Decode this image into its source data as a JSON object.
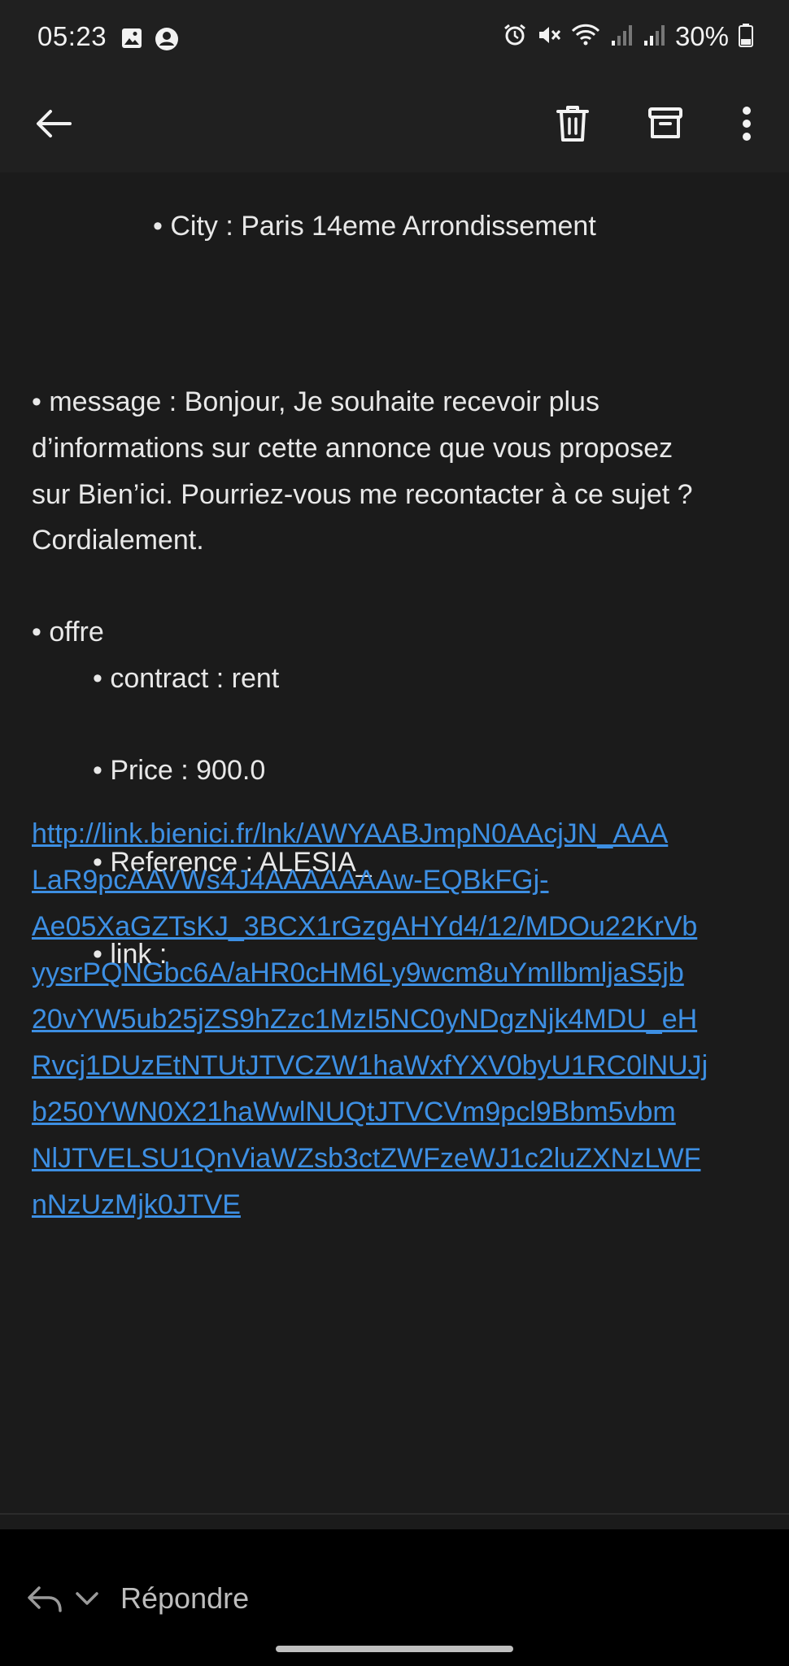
{
  "status_bar": {
    "time": "05:23",
    "battery": "30%",
    "icons": [
      "gallery-icon",
      "account-icon",
      "alarm-icon",
      "mute-icon",
      "wifi-icon",
      "signal-icon",
      "signal-icon",
      "battery-icon"
    ]
  },
  "app_bar": {
    "back_icon": "arrow-left-icon",
    "delete_icon": "trash-icon",
    "archive_icon": "archive-icon",
    "more_icon": "more-vertical-icon"
  },
  "email": {
    "city_line": "• City : Paris 14eme Arrondissement",
    "message_lines": [
      "• message : Bonjour, Je souhaite recevoir plus",
      "d’informations sur cette annonce que vous proposez",
      "sur Bien’ici. Pourriez-vous me recontacter à ce sujet ?",
      "Cordialement."
    ],
    "offre_label": "• offre",
    "contract_line": "• contract : rent",
    "price_line": "• Price : 900.0",
    "reference_line": "• Reference : ALESIA_",
    "link_label": "• link :",
    "link_lines": [
      "http://link.bienici.fr/lnk/AWYAABJmpN0AAcjJN_AAA",
      "LaR9pcAAVWs4J4AAAAAAAw-EQBkFGj-",
      "Ae05XaGZTsKJ_3BCX1rGzgAHYd4/12/MDOu22KrVb",
      "yysrPQNGbc6A/aHR0cHM6Ly9wcm8uYmllbmljaS5jb",
      "20vYW5ub25jZS9hZzc1MzI5NC0yNDgzNjk4MDU_eH",
      "Rvcj1DUzEtNTUtJTVCZW1haWxfYXV0byU1RC0lNUJj",
      "b250YWN0X21haWwlNUQtJTVCVm9pcl9Bbm5vbm",
      "NlJTVELSU1QnViaWZsb3ctZWFzeWJ1c2luZXNzLWF",
      "nNzUzMjk0JTVE"
    ]
  },
  "reply_bar": {
    "label": "Répondre",
    "reply_icon": "reply-icon",
    "chevron_icon": "chevron-down-icon"
  },
  "colors": {
    "background": "#1b1b1b",
    "bar": "#202020",
    "text": "#e8e8e8",
    "link": "#3d8fe3",
    "reply_bar": "#000000"
  }
}
